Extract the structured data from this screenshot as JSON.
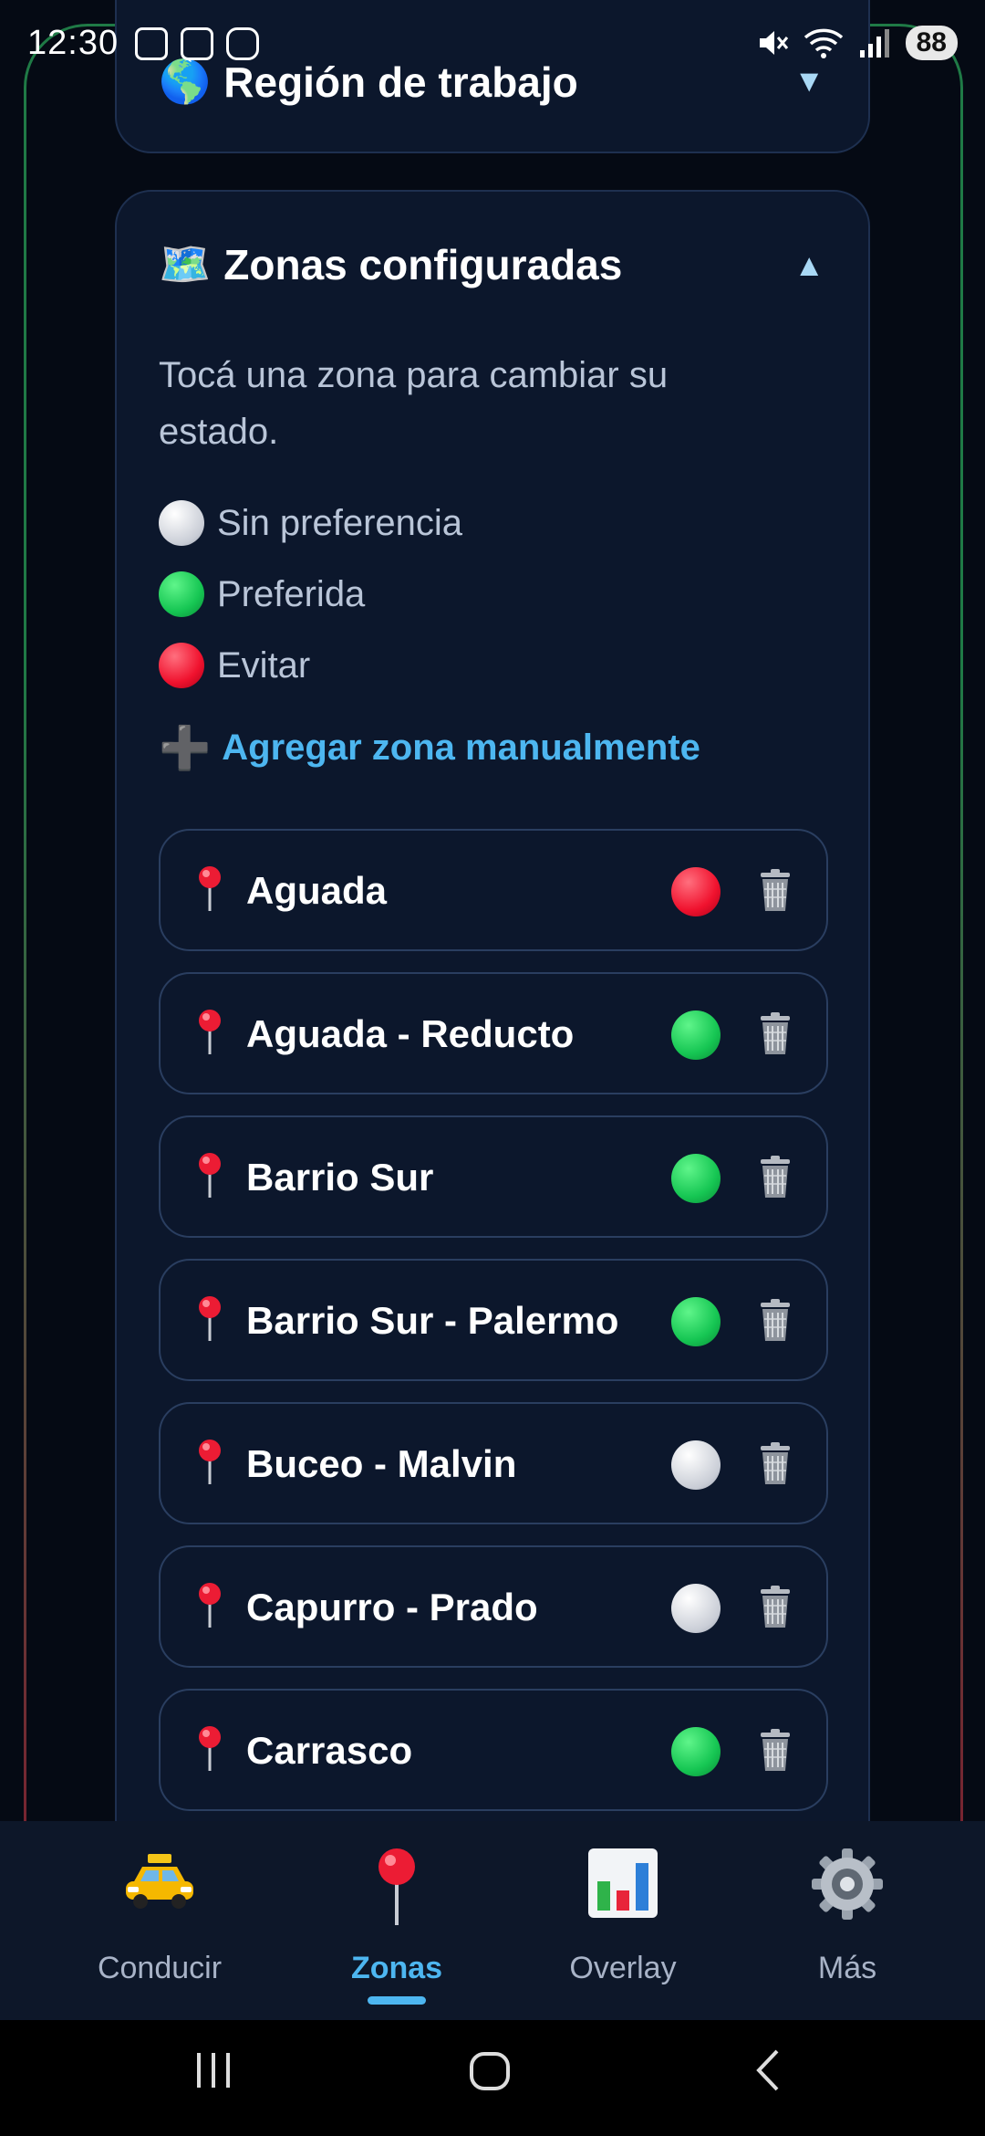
{
  "status_bar": {
    "time": "12:30",
    "battery": "88"
  },
  "region_card": {
    "icon": "🌎",
    "title": "Región de trabajo",
    "chevron": "▼"
  },
  "zones_card": {
    "icon": "🗺️",
    "title": "Zonas configuradas",
    "chevron": "▲",
    "hint": "Tocá una zona para cambiar su estado.",
    "legend": [
      {
        "state": "neutral",
        "label": "Sin preferencia"
      },
      {
        "state": "preferred",
        "label": "Preferida"
      },
      {
        "state": "avoid",
        "label": "Evitar"
      }
    ],
    "add_icon": "➕",
    "add_label": "Agregar zona manualmente",
    "zones": [
      {
        "name": "Aguada",
        "state": "avoid"
      },
      {
        "name": "Aguada - Reducto",
        "state": "preferred"
      },
      {
        "name": "Barrio Sur",
        "state": "preferred"
      },
      {
        "name": "Barrio Sur - Palermo",
        "state": "preferred"
      },
      {
        "name": "Buceo - Malvin",
        "state": "neutral"
      },
      {
        "name": "Capurro - Prado",
        "state": "neutral"
      },
      {
        "name": "Carrasco",
        "state": "preferred"
      }
    ]
  },
  "state_colors": {
    "neutral": "#d8dbe2",
    "preferred": "#16c653",
    "avoid": "#f0122e"
  },
  "bottom_nav": {
    "active": "Zonas",
    "items": [
      {
        "id": "conducir",
        "label": "Conducir",
        "icon": "taxi-icon"
      },
      {
        "id": "zonas",
        "label": "Zonas",
        "icon": "pin-icon"
      },
      {
        "id": "overlay",
        "label": "Overlay",
        "icon": "bar-chart-icon"
      },
      {
        "id": "mas",
        "label": "Más",
        "icon": "gear-icon"
      }
    ]
  }
}
